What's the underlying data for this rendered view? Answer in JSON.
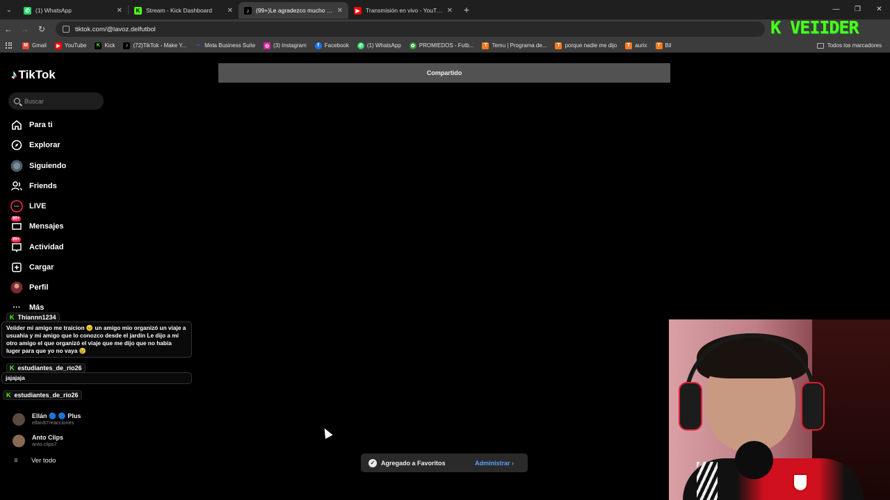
{
  "browser": {
    "tabs": [
      {
        "title": "(1) WhatsApp",
        "favicon": "whatsapp-icon",
        "color": "#25d366",
        "active": false
      },
      {
        "title": "Stream - Kick Dashboard",
        "favicon": "kick-icon",
        "color": "#53fc18",
        "active": false
      },
      {
        "title": "(99+)Le agradezco mucho a @",
        "favicon": "tiktok-icon",
        "color": "#000000",
        "active": true
      },
      {
        "title": "Transmisión en vivo - YouTube",
        "favicon": "youtube-icon",
        "color": "#ff0000",
        "active": false
      }
    ],
    "url": "tiktok.com/@lavoz.delfutbol",
    "overlay_logo": "K VEIIDER",
    "bookmarks": [
      {
        "label": "Gmail",
        "icon": "gmail-icon",
        "color": "#ea4335"
      },
      {
        "label": "YouTube",
        "icon": "youtube-icon",
        "color": "#ff0000"
      },
      {
        "label": "Kick",
        "icon": "kick-icon",
        "color": "#53fc18"
      },
      {
        "label": "(72)TikTok - Make Y...",
        "icon": "tiktok-icon",
        "color": "#000000"
      },
      {
        "label": "Meta Business Suite",
        "icon": "meta-icon",
        "color": "#0866ff"
      },
      {
        "label": "(3) Instagram",
        "icon": "instagram-icon",
        "color": "#d6249f"
      },
      {
        "label": "Facebook",
        "icon": "facebook-icon",
        "color": "#1877f2"
      },
      {
        "label": "(1) WhatsApp",
        "icon": "whatsapp-icon",
        "color": "#25d366"
      },
      {
        "label": "PROMIEDOS - Futb...",
        "icon": "promiedos-icon",
        "color": "#2e9e3a"
      },
      {
        "label": "Temu | Programa de...",
        "icon": "temu-icon",
        "color": "#f47b20"
      },
      {
        "label": "porque nadie me dijo",
        "icon": "temu-icon",
        "color": "#f47b20"
      },
      {
        "label": "aurix",
        "icon": "temu-icon",
        "color": "#f47b20"
      },
      {
        "label": "Bil",
        "icon": "temu-icon",
        "color": "#f47b20"
      }
    ],
    "all_bookmarks": "Todos los marcadores"
  },
  "tiktok": {
    "logo": "TikTok",
    "search_placeholder": "Buscar",
    "nav": [
      {
        "label": "Para ti",
        "icon": "home-icon"
      },
      {
        "label": "Explorar",
        "icon": "compass-icon"
      },
      {
        "label": "Siguiendo",
        "icon": "following-avatar-icon"
      },
      {
        "label": "Friends",
        "icon": "friends-icon"
      },
      {
        "label": "LIVE",
        "icon": "live-icon"
      },
      {
        "label": "Mensajes",
        "icon": "messages-icon",
        "badge": "99+"
      },
      {
        "label": "Actividad",
        "icon": "activity-icon",
        "badge": "99+"
      },
      {
        "label": "Cargar",
        "icon": "upload-icon"
      },
      {
        "label": "Perfil",
        "icon": "profile-icon"
      },
      {
        "label": "Más",
        "icon": "more-icon"
      }
    ],
    "following": [
      {
        "name": "Ellán 🔵 🔵 Plus",
        "handle": "ellan87reacciones"
      },
      {
        "name": "Anto Clips",
        "handle": "anto.clips7"
      }
    ],
    "see_all": "Ver todo",
    "shared_label": "Compartido",
    "toast": {
      "message": "Agregado a Favoritos",
      "action": "Administrar"
    }
  },
  "chat": {
    "messages": [
      {
        "user": "Thiannn1234",
        "text": "Veiider mi amigo me traicion 😐 un amigo mio organizó un viaje a usuahia y mi amigo que lo conozco desde el jardin Le dijo a mi otro amigo el que organizó el viaje que me dijo que no habia luger para que yo no vaya 😢"
      },
      {
        "user": "estudiantes_de_rio26",
        "text": "jajajaja"
      },
      {
        "user": "estudiantes_de_rio26",
        "text": ""
      }
    ]
  }
}
